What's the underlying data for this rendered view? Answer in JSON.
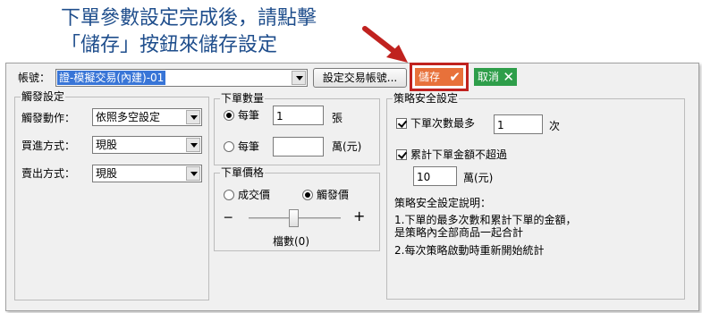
{
  "banner": {
    "line1": "下單參數設定完成後，請點擊",
    "line2": "「儲存」按鈕來儲存設定"
  },
  "account": {
    "label": "帳號：",
    "selected": "證-模擬交易(內建)-01",
    "set_button": "設定交易帳號..."
  },
  "actions": {
    "save_label": "儲存",
    "save_icon": "check-icon",
    "cancel_label": "取消",
    "cancel_icon": "x-icon",
    "save_color": "#e8713a",
    "cancel_color": "#2e9e4a",
    "highlight_color": "#c0221f"
  },
  "trigger": {
    "title": "觸發設定",
    "action_label": "觸發動作：",
    "action_value": "依照多空設定",
    "buy_label": "買進方式：",
    "buy_value": "現股",
    "sell_label": "賣出方式：",
    "sell_value": "現股"
  },
  "quantity": {
    "title": "下單數量",
    "opt1_label": "每筆",
    "opt1_value": "1",
    "opt1_unit": "張",
    "opt2_label": "每筆",
    "opt2_value": "",
    "opt2_unit": "萬(元)",
    "selected": "opt1"
  },
  "price": {
    "title": "下單價格",
    "opt1_label": "成交價",
    "opt2_label": "觸發價",
    "selected": "opt2",
    "minus": "─",
    "plus": "+",
    "tick_label": "檔數(0)",
    "tick_value": 0
  },
  "safety": {
    "title": "策略安全設定",
    "max_orders_label": "下單次數最多",
    "max_orders_value": "1",
    "max_orders_unit": "次",
    "max_orders_checked": true,
    "max_amount_label": "累計下單金額不超過",
    "max_amount_value": "10",
    "max_amount_unit": "萬(元)",
    "max_amount_checked": true,
    "desc_title": "策略安全設定說明：",
    "desc_line1": "1.下單的最多次數和累計下單的金額，",
    "desc_line2": "是策略內全部商品一起合計",
    "desc_line3": "2.每次策略啟動時重新開始統計"
  }
}
